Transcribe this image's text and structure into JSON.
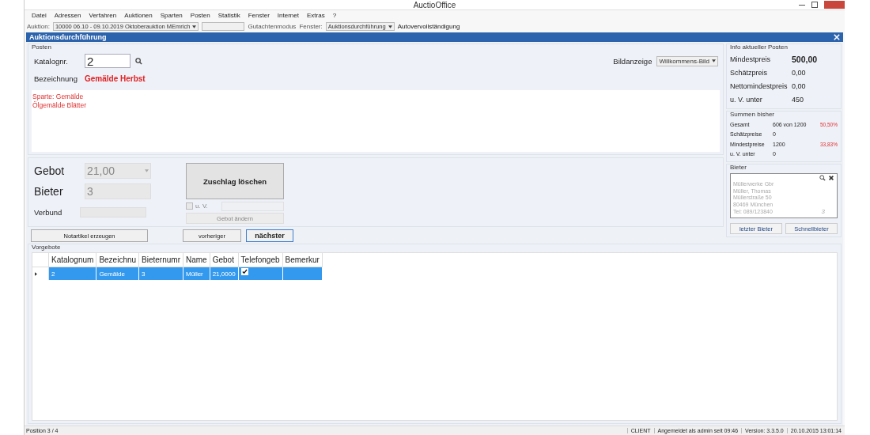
{
  "window": {
    "title": "AuctioOffice"
  },
  "menu": [
    "Datei",
    "Adressen",
    "Verfahren",
    "Auktionen",
    "Sparten",
    "Posten",
    "Statistik",
    "Fenster",
    "Internet",
    "Extras",
    "?"
  ],
  "toolbar": {
    "auction_label": "Auktion:",
    "auction": "10000 06.10 - 09.10.2019 Oktoberauktion MEmrich",
    "gutachten": "Gutachtenmodus",
    "fenster_label": "Fenster:",
    "fenster": "Auktionsdurchführung",
    "auto": "Autovervollständigung"
  },
  "child_window": {
    "title": "Auktionsdurchführung"
  },
  "posten": {
    "legend": "Posten",
    "katalog_label": "Katalognr.",
    "katalog_value": "2",
    "bezeichnung_label": "Bezeichnung",
    "bezeichnung": "Gemälde Herbst",
    "bild_label": "Bildanzeige",
    "bild_value": "Willkommens-Bild",
    "notes": [
      "Sparte: Gemälde",
      "Ölgemälde Blätter"
    ]
  },
  "bid": {
    "gebot_label": "Gebot",
    "gebot": "21,00",
    "bieter_label": "Bieter",
    "bieter": "3",
    "verbund_label": "Verbund",
    "zuschlag": "Zuschlag löschen",
    "uv": {
      "label": "u. V.",
      "checked": false
    },
    "gebot_aendern": {
      "label": "Gebot ändern",
      "disabled": true
    }
  },
  "actions": [
    {
      "label": "Notartikel erzeugen",
      "default": false
    },
    {
      "label": "vorheriger",
      "default": false
    },
    {
      "label": "nächster",
      "default": true
    }
  ],
  "info": {
    "legend": "Info aktueller Posten",
    "rows": [
      {
        "label": "Mindestpreis",
        "value": "500,00",
        "emphasis": true
      },
      {
        "label": "Schätzpreis",
        "value": "0,00",
        "emphasis": false
      },
      {
        "label": "Nettomindestpreis",
        "value": "0,00",
        "emphasis": false
      },
      {
        "label": "u. V. unter",
        "value": "450",
        "emphasis": false
      }
    ]
  },
  "summen": {
    "legend": "Summen bisher",
    "rows": [
      {
        "label": "Gesamt",
        "value": "606 von 1200",
        "percent": "50,50%"
      },
      {
        "label": "Schätzpreise",
        "value": "0"
      },
      {
        "label": "Mindestpreise",
        "value": "1200",
        "percent": "33,83%"
      },
      {
        "label": "u. V. unter",
        "value": "0"
      }
    ]
  },
  "bieter": {
    "legend": "Bieter",
    "lines": [
      "Müllerwerke Gbr",
      "Müller, Thomas",
      "Müllerstraße 50",
      "80469 München",
      "Tel: 089/123840"
    ],
    "number": "3",
    "buttons": [
      "letzter Bieter",
      "Schnellbieter"
    ]
  },
  "vorgebote": {
    "legend": "Vorgebote",
    "columns": [
      "Katalognum",
      "Bezeichnu",
      "Bieternumr",
      "Name",
      "Gebot",
      "Telefongeb",
      "Bemerkur"
    ],
    "rows": [
      {
        "selected": true,
        "cells": [
          "2",
          "Gemälde",
          "3",
          "Müller",
          "21,0000"
        ],
        "telefongebot": true
      }
    ]
  },
  "status_bar": {
    "position": "Position 3 / 4",
    "items": [
      "CLIENT",
      "Angemeldet als admin seit 09:46",
      "Version: 3.3.5.0",
      "20.10.2015 13:01:14"
    ]
  }
}
